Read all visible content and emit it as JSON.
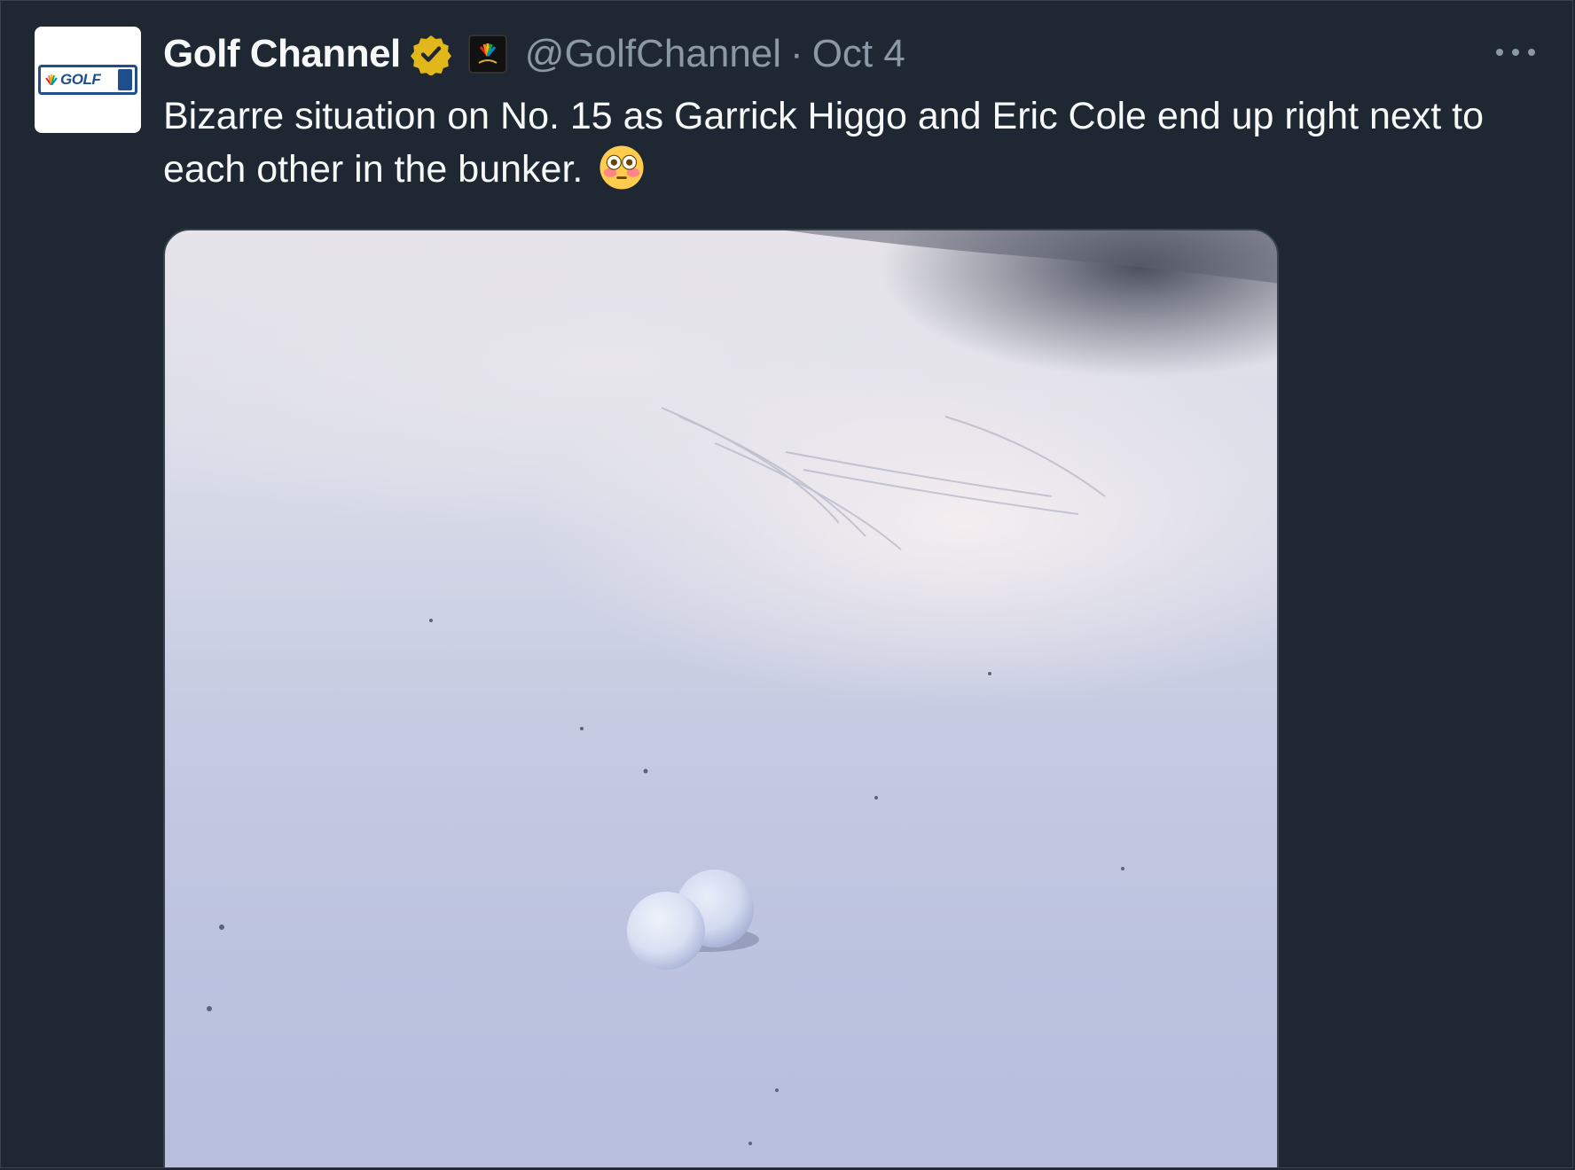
{
  "tweet": {
    "author_name": "Golf Channel",
    "handle": "@GolfChannel",
    "separator": "·",
    "date": "Oct 4",
    "text": "Bizarre situation on No. 15 as Garrick Higgo and Eric Cole end up right next to each other in the bunker.",
    "emoji": "flushed-face-emoji",
    "avatar_text": "GOLF",
    "verified_badge_color": "#e2b719",
    "media_description_icon": "two-golf-balls-in-bunker-image"
  },
  "colors": {
    "background": "#1e2732",
    "primary_text": "#f7f9f9",
    "secondary_text": "#8b98a5",
    "border": "#38444d",
    "brand": "#1f4e8c"
  },
  "icons": {
    "more": "more-options-icon",
    "verified": "verified-badge-icon",
    "affiliate": "nbc-sports-affiliate-icon"
  }
}
